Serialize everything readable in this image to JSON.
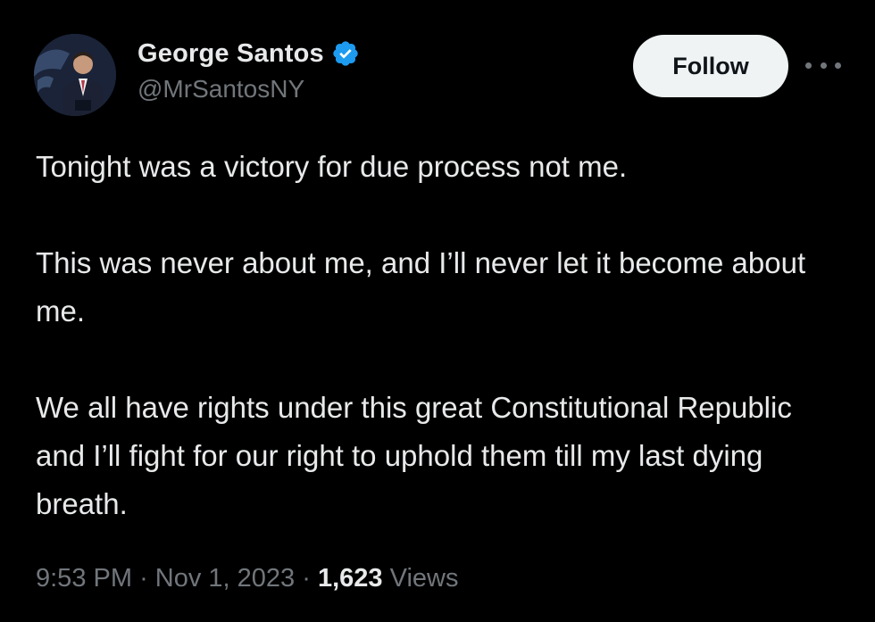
{
  "author": {
    "display_name": "George Santos",
    "handle": "@MrSantosNY",
    "verified": true,
    "verified_icon": "verified-badge-icon",
    "avatar_icon": "profile-photo"
  },
  "actions": {
    "follow_label": "Follow",
    "more_icon": "more-options-icon"
  },
  "tweet": {
    "paragraphs": [
      "Tonight was a victory for due process not me.",
      "This was never about me, and I’ll never let it become about me.",
      "We all have rights under this great Constitutional Republic and I’ll fight for our right to uphold them till my last dying breath."
    ]
  },
  "meta": {
    "time": "9:53 PM",
    "separator": "·",
    "date": "Nov 1, 2023",
    "views_count": "1,623",
    "views_label": "Views"
  },
  "colors": {
    "background": "#000000",
    "text_primary": "#e7e9ea",
    "text_secondary": "#71767b",
    "verified_blue": "#1d9bf0",
    "follow_bg": "#eff3f4"
  }
}
